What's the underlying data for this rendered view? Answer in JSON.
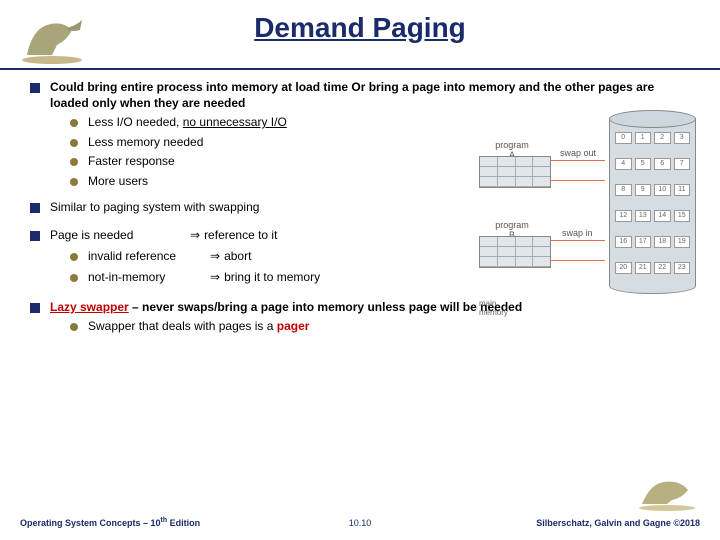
{
  "title": "Demand Paging",
  "bullets": {
    "b1": "Could bring entire process into memory at load time Or bring a page into memory and the other pages are loaded only when they are needed",
    "b1_sub": [
      "Less I/O needed, ",
      "Less memory needed",
      "Faster response",
      "More users"
    ],
    "b1_sub0_underline": "no unnecessary I/O",
    "b2": "Similar to paging system with swapping",
    "b3": {
      "left": [
        "Page is needed",
        "invalid reference",
        "not-in-memory"
      ],
      "right": [
        "reference to it",
        "abort",
        "bring it to memory"
      ]
    },
    "b4_pre": "Lazy swapper",
    "b4_rest": " – never swaps/bring a page into memory unless page will be needed",
    "b4_sub": "Swapper that deals with pages is a ",
    "b4_sub_red": "pager"
  },
  "diagram": {
    "progA": "program\nA",
    "progB": "program\nB",
    "mainmem": "main\nmemory",
    "swapout": "swap out",
    "swapin": "swap in",
    "rows": [
      [
        "0",
        "1",
        "2",
        "3"
      ],
      [
        "4",
        "5",
        "6",
        "7"
      ],
      [
        "8",
        "9",
        "10",
        "11"
      ],
      [
        "12",
        "13",
        "14",
        "15"
      ],
      [
        "16",
        "17",
        "18",
        "19"
      ],
      [
        "20",
        "21",
        "22",
        "23"
      ]
    ]
  },
  "footer": {
    "left_a": "Operating System Concepts – 10",
    "left_b": " Edition",
    "mid": "10.10",
    "right": "Silberschatz, Galvin and Gagne ©2018"
  }
}
